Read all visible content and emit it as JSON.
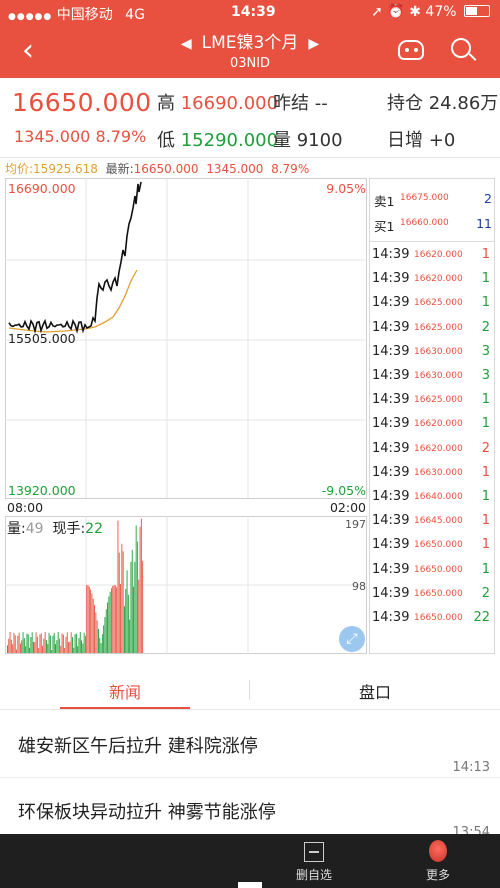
{
  "status": {
    "carrier": "中国移动",
    "network": "4G",
    "time": "14:39",
    "battery": "47%",
    "icons": [
      "location-icon",
      "alarm-icon",
      "bluetooth-icon"
    ]
  },
  "header": {
    "title": "LME镍3个月",
    "subtitle": "03NID",
    "back_icon": "chevron-left-icon",
    "prev_icon": "triangle-left-icon",
    "next_icon": "triangle-right-icon",
    "bot_icon": "robot-icon",
    "search_icon": "search-icon"
  },
  "quote": {
    "last": "16650.000",
    "change": "1345.000",
    "change_pct": "8.79%",
    "high_label": "高",
    "high": "16690.000",
    "prev_label": "昨结",
    "prev": "--",
    "low_label": "低",
    "low": "15290.000",
    "vol_label": "量",
    "vol": "9100",
    "oi_label": "持仓",
    "oi": "24.86万",
    "daily_label": "日增",
    "daily": "+0"
  },
  "info": {
    "avg_label": "均价:",
    "avg": "15925.618",
    "latest_label": "最新:",
    "latest": "16650.000",
    "chg": "1345.000",
    "pct": "8.79%"
  },
  "chart": {
    "y_top": "16690.000",
    "y_mid": "15505.000",
    "y_bottom": "13920.000",
    "pct_top": "9.05%",
    "pct_bottom": "-9.05%",
    "t_start": "08:00",
    "t_end": "02:00",
    "vol_label": "量:",
    "vol_value": "49",
    "hand_label": "现手:",
    "hand_value": "22",
    "vol_max": "197",
    "vol_mid": "98",
    "expand_icon": "expand-icon"
  },
  "book": {
    "sell": {
      "label": "卖1",
      "price": "16675.000",
      "vol": "2"
    },
    "buy": {
      "label": "买1",
      "price": "16660.000",
      "vol": "11"
    },
    "trades": [
      {
        "t": "14:39",
        "p": "16620.000",
        "v": "1",
        "c": "red"
      },
      {
        "t": "14:39",
        "p": "16620.000",
        "v": "1",
        "c": "green"
      },
      {
        "t": "14:39",
        "p": "16625.000",
        "v": "1",
        "c": "green"
      },
      {
        "t": "14:39",
        "p": "16625.000",
        "v": "2",
        "c": "green"
      },
      {
        "t": "14:39",
        "p": "16630.000",
        "v": "3",
        "c": "green"
      },
      {
        "t": "14:39",
        "p": "16630.000",
        "v": "3",
        "c": "green"
      },
      {
        "t": "14:39",
        "p": "16625.000",
        "v": "1",
        "c": "green"
      },
      {
        "t": "14:39",
        "p": "16620.000",
        "v": "1",
        "c": "green"
      },
      {
        "t": "14:39",
        "p": "16620.000",
        "v": "2",
        "c": "red"
      },
      {
        "t": "14:39",
        "p": "16630.000",
        "v": "1",
        "c": "red"
      },
      {
        "t": "14:39",
        "p": "16640.000",
        "v": "1",
        "c": "green"
      },
      {
        "t": "14:39",
        "p": "16645.000",
        "v": "1",
        "c": "red"
      },
      {
        "t": "14:39",
        "p": "16650.000",
        "v": "1",
        "c": "red"
      },
      {
        "t": "14:39",
        "p": "16650.000",
        "v": "1",
        "c": "green"
      },
      {
        "t": "14:39",
        "p": "16650.000",
        "v": "2",
        "c": "green"
      },
      {
        "t": "14:39",
        "p": "16650.000",
        "v": "22",
        "c": "green"
      }
    ]
  },
  "tabs": {
    "news": "新闻",
    "book": "盘口"
  },
  "news": [
    {
      "headline": "雄安新区午后拉升 建科院涨停",
      "time": "14:13"
    },
    {
      "headline": "环保板块异动拉升 神雾节能涨停",
      "time": "13:54"
    }
  ],
  "bottom": {
    "remove_label": "删自选",
    "remove_icon": "minus-square-icon",
    "more_label": "更多",
    "more_icon": "more-dot-icon"
  },
  "colors": {
    "accent": "#e8513f",
    "up": "#e8513f",
    "down": "#1f9e3a",
    "avg_line": "#e0a030"
  }
}
